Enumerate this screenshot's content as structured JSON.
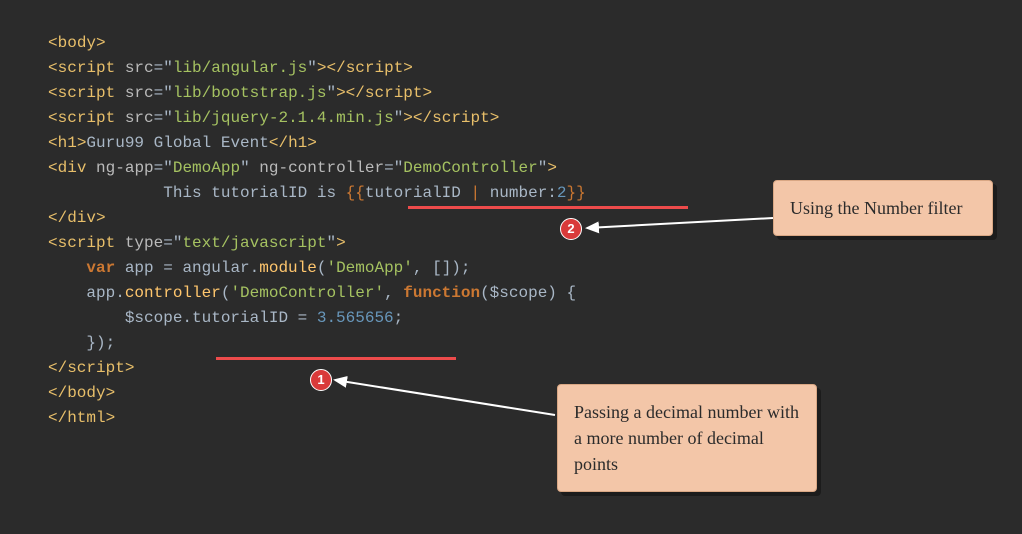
{
  "code": {
    "l1": {
      "a": "<",
      "b": "body",
      "c": ">"
    },
    "l2": {
      "a": "<",
      "b": "script",
      "sp": " ",
      "attr": "src",
      "eq": "=\"",
      "val": "lib/angular.js",
      "cq": "\"",
      "c": "></",
      "d": "script",
      "e": ">"
    },
    "l3": {
      "a": "<",
      "b": "script",
      "sp": " ",
      "attr": "src",
      "eq": "=\"",
      "val": "lib/bootstrap.js",
      "cq": "\"",
      "c": "></",
      "d": "script",
      "e": ">"
    },
    "l4": {
      "a": "<",
      "b": "script",
      "sp": " ",
      "attr": "src",
      "eq": "=\"",
      "val": "lib/jquery-2.1.4.min.js",
      "cq": "\"",
      "c": "></",
      "d": "script",
      "e": ">"
    },
    "l5": {
      "a": "<",
      "b": "h1",
      "c": ">",
      "txt": "Guru99 Global Event",
      "d": "</",
      "e": "h1",
      "f": ">"
    },
    "l6": {
      "a": "<",
      "b": "div",
      "sp": " ",
      "a1": "ng-app",
      "eq1": "=\"",
      "v1": "DemoApp",
      "cq1": "\" ",
      "a2": "ng-controller",
      "eq2": "=\"",
      "v2": "DemoController",
      "cq2": "\"",
      "c": ">"
    },
    "l7": {
      "pad": "            ",
      "txt": "This tutorialID is ",
      "op": "{{",
      "var": "tutorialID ",
      "pipe": "| ",
      "flt": "number:",
      "num": "2",
      "cl": "}}"
    },
    "l8": {
      "a": "</",
      "b": "div",
      "c": ">"
    },
    "l9": {
      "a": "<",
      "b": "script",
      "sp": " ",
      "attr": "type",
      "eq": "=\"",
      "val": "text/javascript",
      "cq": "\"",
      "c": ">"
    },
    "l10": {
      "pad": "    ",
      "kw": "var",
      "sp": " ",
      "id": "app = angular.",
      "fn": "module",
      "op": "(",
      "s": "'DemoApp'",
      "cm": ", []);"
    },
    "l11": {
      "pad": "    ",
      "pre": "app.",
      "fn": "controller",
      "op": "(",
      "s": "'DemoController'",
      "cm": ", ",
      "kw": "function",
      "arg": "($scope) {"
    },
    "l12": {
      "pad": "        ",
      "pre": "$scope.tutorialID = ",
      "num": "3.565656",
      "end": ";"
    },
    "l13": {
      "pad": "    ",
      "end": "});"
    },
    "l14": {
      "a": "</",
      "b": "script",
      "c": ">"
    },
    "l15": {
      "a": "</",
      "b": "body",
      "c": ">"
    },
    "l16": {
      "a": "</",
      "b": "html",
      "c": ">"
    }
  },
  "badge1": "1",
  "badge2": "2",
  "callout1": "Using the Number filter",
  "callout2": "Passing a decimal number with a more number of decimal points"
}
